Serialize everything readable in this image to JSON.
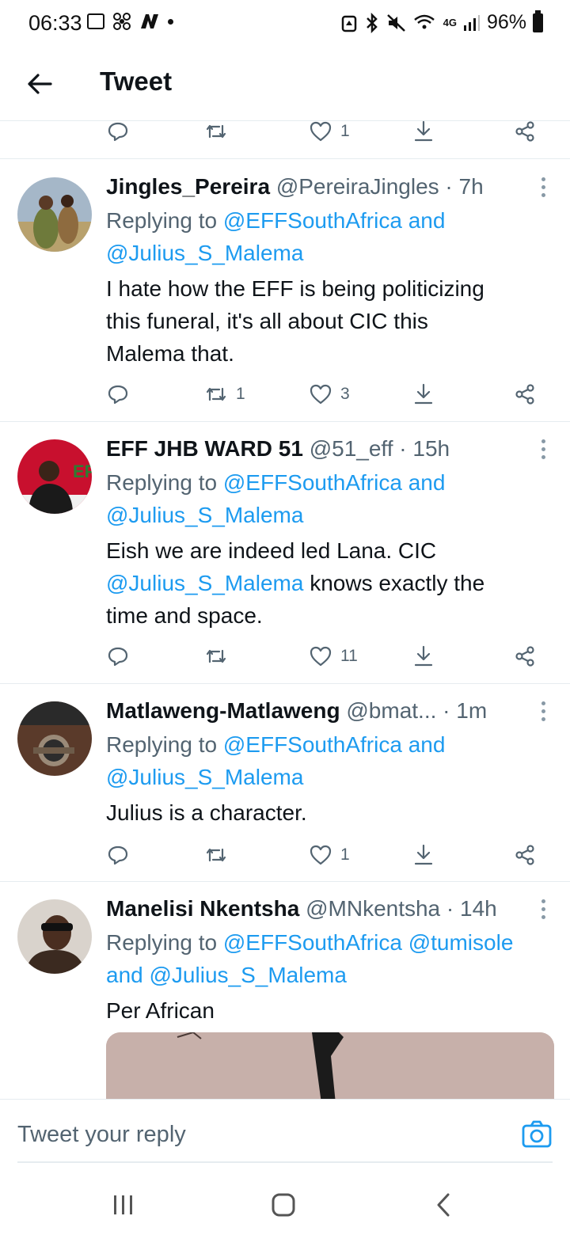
{
  "status_bar": {
    "time": "06:33",
    "battery": "96%",
    "network": "4G"
  },
  "header": {
    "title": "Tweet"
  },
  "top_actions": {
    "likes": "1"
  },
  "tweets": [
    {
      "name": "Jingles_Pereira",
      "handle": "@PereiraJingles",
      "sep": " · ",
      "time": "7h",
      "replying_prefix": "Replying to ",
      "replying_to": "@EFFSouthAfrica and",
      "replying_to_2": "@Julius_S_Malema",
      "text_1": "I hate how the EFF is being politicizing",
      "text_2": "this funeral, it's all about CIC this",
      "text_3": "Malema that.",
      "retweets": "1",
      "likes": "3"
    },
    {
      "name": "EFF JHB WARD 51",
      "handle": "@51_eff",
      "sep": " · ",
      "time": "15h",
      "replying_prefix": "Replying to ",
      "replying_to": "@EFFSouthAfrica and",
      "replying_to_2": "@Julius_S_Malema",
      "text_1": "Eish we are indeed led Lana. CIC",
      "text_2_link": "@Julius_S_Malema",
      "text_2_rest": " knows exactly the",
      "text_3": "time and space.",
      "retweets": "",
      "likes": "11"
    },
    {
      "name": "Matlaweng-Matlaweng",
      "handle": "@bmat...",
      "sep": " · ",
      "time": "1m",
      "replying_prefix": "Replying to ",
      "replying_to": "@EFFSouthAfrica and",
      "replying_to_2": "@Julius_S_Malema",
      "text_1": "Julius is a character.",
      "retweets": "",
      "likes": "1"
    },
    {
      "name": "Manelisi Nkentsha",
      "handle": "@MNkentsha",
      "sep": " · ",
      "time": "14h",
      "replying_prefix": "Replying to ",
      "replying_to": "@EFFSouthAfrica @tumisole",
      "replying_to_2_prefix": "and ",
      "replying_to_2": "@Julius_S_Malema",
      "text_1": "Per African"
    }
  ],
  "reply_bar": {
    "placeholder": "Tweet your reply"
  },
  "colors": {
    "link": "#1d9bf0",
    "muted": "#536471",
    "text": "#0f1419"
  }
}
